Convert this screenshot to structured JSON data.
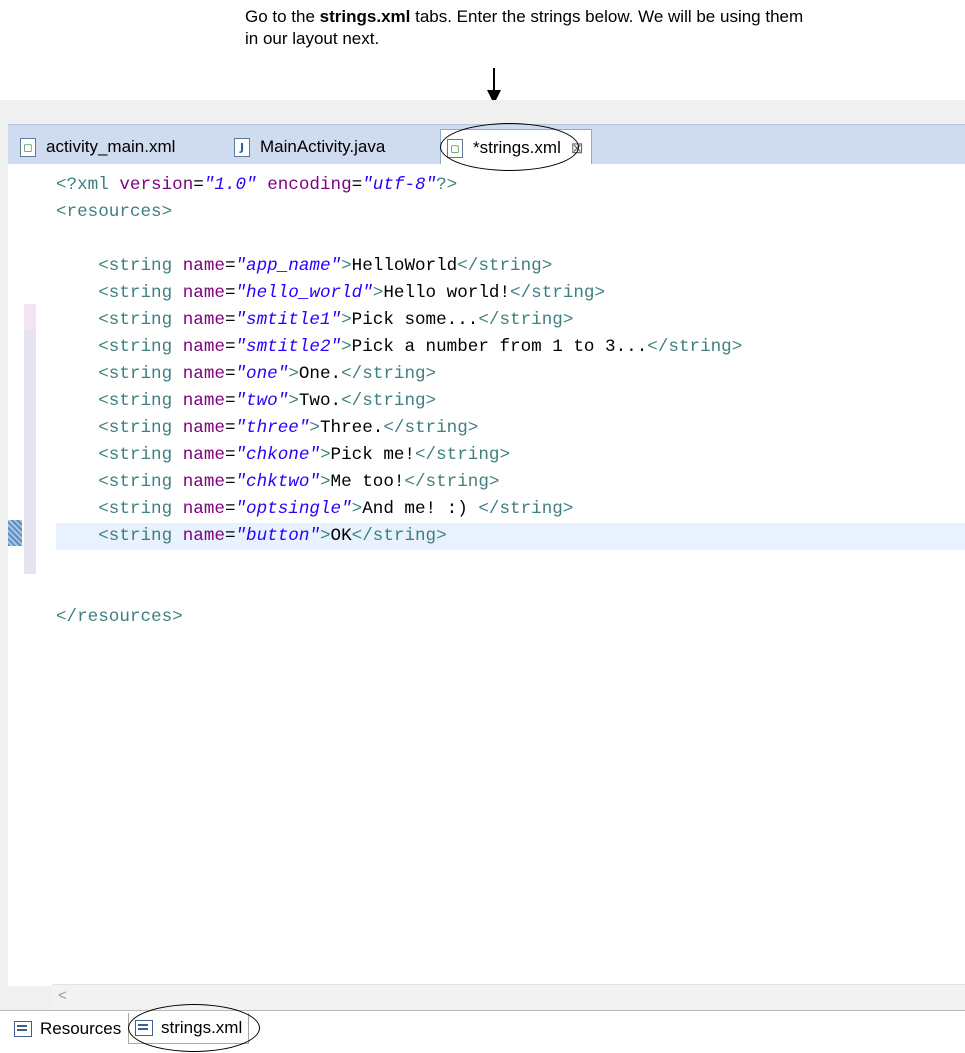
{
  "annotation": {
    "text_before": "Go to the ",
    "text_bold": "strings.xml",
    "text_after": " tabs. Enter the strings below. We will be using them in our layout next."
  },
  "editor_tabs": [
    {
      "label": "activity_main.xml",
      "icon": "xml-file-icon",
      "active": false
    },
    {
      "label": "MainActivity.java",
      "icon": "java-file-icon",
      "active": false
    },
    {
      "label": "*strings.xml",
      "icon": "xml-file-icon",
      "active": true,
      "close_icon": "close-icon"
    }
  ],
  "code_lines": [
    [
      {
        "c": "br",
        "t": "<?xml "
      },
      {
        "c": "attr",
        "t": "version"
      },
      {
        "c": "txt",
        "t": "="
      },
      {
        "c": "val",
        "t": "\"1.0\""
      },
      {
        "c": "txt",
        "t": " "
      },
      {
        "c": "attr",
        "t": "encoding"
      },
      {
        "c": "txt",
        "t": "="
      },
      {
        "c": "val",
        "t": "\"utf-8\""
      },
      {
        "c": "br",
        "t": "?>"
      }
    ],
    [
      {
        "c": "br",
        "t": "<resources>"
      }
    ],
    [],
    [
      {
        "c": "txt",
        "t": "    "
      },
      {
        "c": "br",
        "t": "<string "
      },
      {
        "c": "attr",
        "t": "name"
      },
      {
        "c": "txt",
        "t": "="
      },
      {
        "c": "val",
        "t": "\"app_name\""
      },
      {
        "c": "br",
        "t": ">"
      },
      {
        "c": "txt",
        "t": "HelloWorld"
      },
      {
        "c": "br",
        "t": "</string>"
      }
    ],
    [
      {
        "c": "txt",
        "t": "    "
      },
      {
        "c": "br",
        "t": "<string "
      },
      {
        "c": "attr",
        "t": "name"
      },
      {
        "c": "txt",
        "t": "="
      },
      {
        "c": "val",
        "t": "\"hello_world\""
      },
      {
        "c": "br",
        "t": ">"
      },
      {
        "c": "txt",
        "t": "Hello world!"
      },
      {
        "c": "br",
        "t": "</string>"
      }
    ],
    [
      {
        "c": "txt",
        "t": "    "
      },
      {
        "c": "br",
        "t": "<string "
      },
      {
        "c": "attr",
        "t": "name"
      },
      {
        "c": "txt",
        "t": "="
      },
      {
        "c": "val",
        "t": "\"smtitle1\""
      },
      {
        "c": "br",
        "t": ">"
      },
      {
        "c": "txt",
        "t": "Pick some..."
      },
      {
        "c": "br",
        "t": "</string>"
      }
    ],
    [
      {
        "c": "txt",
        "t": "    "
      },
      {
        "c": "br",
        "t": "<string "
      },
      {
        "c": "attr",
        "t": "name"
      },
      {
        "c": "txt",
        "t": "="
      },
      {
        "c": "val",
        "t": "\"smtitle2\""
      },
      {
        "c": "br",
        "t": ">"
      },
      {
        "c": "txt",
        "t": "Pick a number from 1 to 3..."
      },
      {
        "c": "br",
        "t": "</string>"
      }
    ],
    [
      {
        "c": "txt",
        "t": "    "
      },
      {
        "c": "br",
        "t": "<string "
      },
      {
        "c": "attr",
        "t": "name"
      },
      {
        "c": "txt",
        "t": "="
      },
      {
        "c": "val",
        "t": "\"one\""
      },
      {
        "c": "br",
        "t": ">"
      },
      {
        "c": "txt",
        "t": "One."
      },
      {
        "c": "br",
        "t": "</string>"
      }
    ],
    [
      {
        "c": "txt",
        "t": "    "
      },
      {
        "c": "br",
        "t": "<string "
      },
      {
        "c": "attr",
        "t": "name"
      },
      {
        "c": "txt",
        "t": "="
      },
      {
        "c": "val",
        "t": "\"two\""
      },
      {
        "c": "br",
        "t": ">"
      },
      {
        "c": "txt",
        "t": "Two."
      },
      {
        "c": "br",
        "t": "</string>"
      }
    ],
    [
      {
        "c": "txt",
        "t": "    "
      },
      {
        "c": "br",
        "t": "<string "
      },
      {
        "c": "attr",
        "t": "name"
      },
      {
        "c": "txt",
        "t": "="
      },
      {
        "c": "val",
        "t": "\"three\""
      },
      {
        "c": "br",
        "t": ">"
      },
      {
        "c": "txt",
        "t": "Three."
      },
      {
        "c": "br",
        "t": "</string>"
      }
    ],
    [
      {
        "c": "txt",
        "t": "    "
      },
      {
        "c": "br",
        "t": "<string "
      },
      {
        "c": "attr",
        "t": "name"
      },
      {
        "c": "txt",
        "t": "="
      },
      {
        "c": "val",
        "t": "\"chkone\""
      },
      {
        "c": "br",
        "t": ">"
      },
      {
        "c": "txt",
        "t": "Pick me!"
      },
      {
        "c": "br",
        "t": "</string>"
      }
    ],
    [
      {
        "c": "txt",
        "t": "    "
      },
      {
        "c": "br",
        "t": "<string "
      },
      {
        "c": "attr",
        "t": "name"
      },
      {
        "c": "txt",
        "t": "="
      },
      {
        "c": "val",
        "t": "\"chktwo\""
      },
      {
        "c": "br",
        "t": ">"
      },
      {
        "c": "txt",
        "t": "Me too!"
      },
      {
        "c": "br",
        "t": "</string>"
      }
    ],
    [
      {
        "c": "txt",
        "t": "    "
      },
      {
        "c": "br",
        "t": "<string "
      },
      {
        "c": "attr",
        "t": "name"
      },
      {
        "c": "txt",
        "t": "="
      },
      {
        "c": "val",
        "t": "\"optsingle\""
      },
      {
        "c": "br",
        "t": ">"
      },
      {
        "c": "txt",
        "t": "And me! :) "
      },
      {
        "c": "br",
        "t": "</string>"
      }
    ],
    [
      {
        "c": "txt",
        "t": "    "
      },
      {
        "c": "br",
        "t": "<string "
      },
      {
        "c": "attr",
        "t": "name"
      },
      {
        "c": "txt",
        "t": "="
      },
      {
        "c": "val",
        "t": "\"button\""
      },
      {
        "c": "br",
        "t": ">"
      },
      {
        "c": "txt",
        "t": "OK"
      },
      {
        "c": "br",
        "t": "</string>"
      }
    ],
    [],
    [],
    [
      {
        "c": "br",
        "t": "</resources>"
      }
    ]
  ],
  "current_line_index": 13,
  "bottom_tabs": [
    {
      "label": "Resources",
      "icon": "resources-icon",
      "active": false
    },
    {
      "label": "strings.xml",
      "icon": "source-icon",
      "active": true
    }
  ],
  "scroll_left_glyph": "<",
  "colors": {
    "tag": "#3f7f7f",
    "attribute": "#7f007f",
    "value": "#2a00ff",
    "text": "#000000",
    "tabbar": "#cfdcef",
    "current_line": "#e8f2fe"
  }
}
